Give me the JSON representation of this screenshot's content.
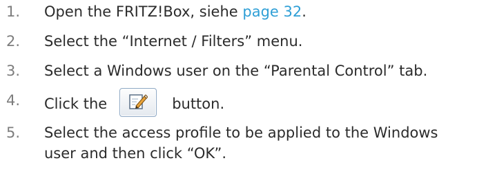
{
  "steps": [
    {
      "num": "1.",
      "text": "Open the FRITZ!Box, siehe ",
      "link": "page 32",
      "end": "."
    },
    {
      "num": "2.",
      "text": "Select the “Internet / Filters” menu."
    },
    {
      "num": "3.",
      "text": "Select a Windows user on the “Parental Control” tab."
    },
    {
      "num": "4.",
      "before": "Click the",
      "after": "button.",
      "icon": "edit-icon"
    },
    {
      "num": "5.",
      "line1": "Select the access profile to be applied to the Windows",
      "line2": "user and then click “OK”."
    }
  ]
}
